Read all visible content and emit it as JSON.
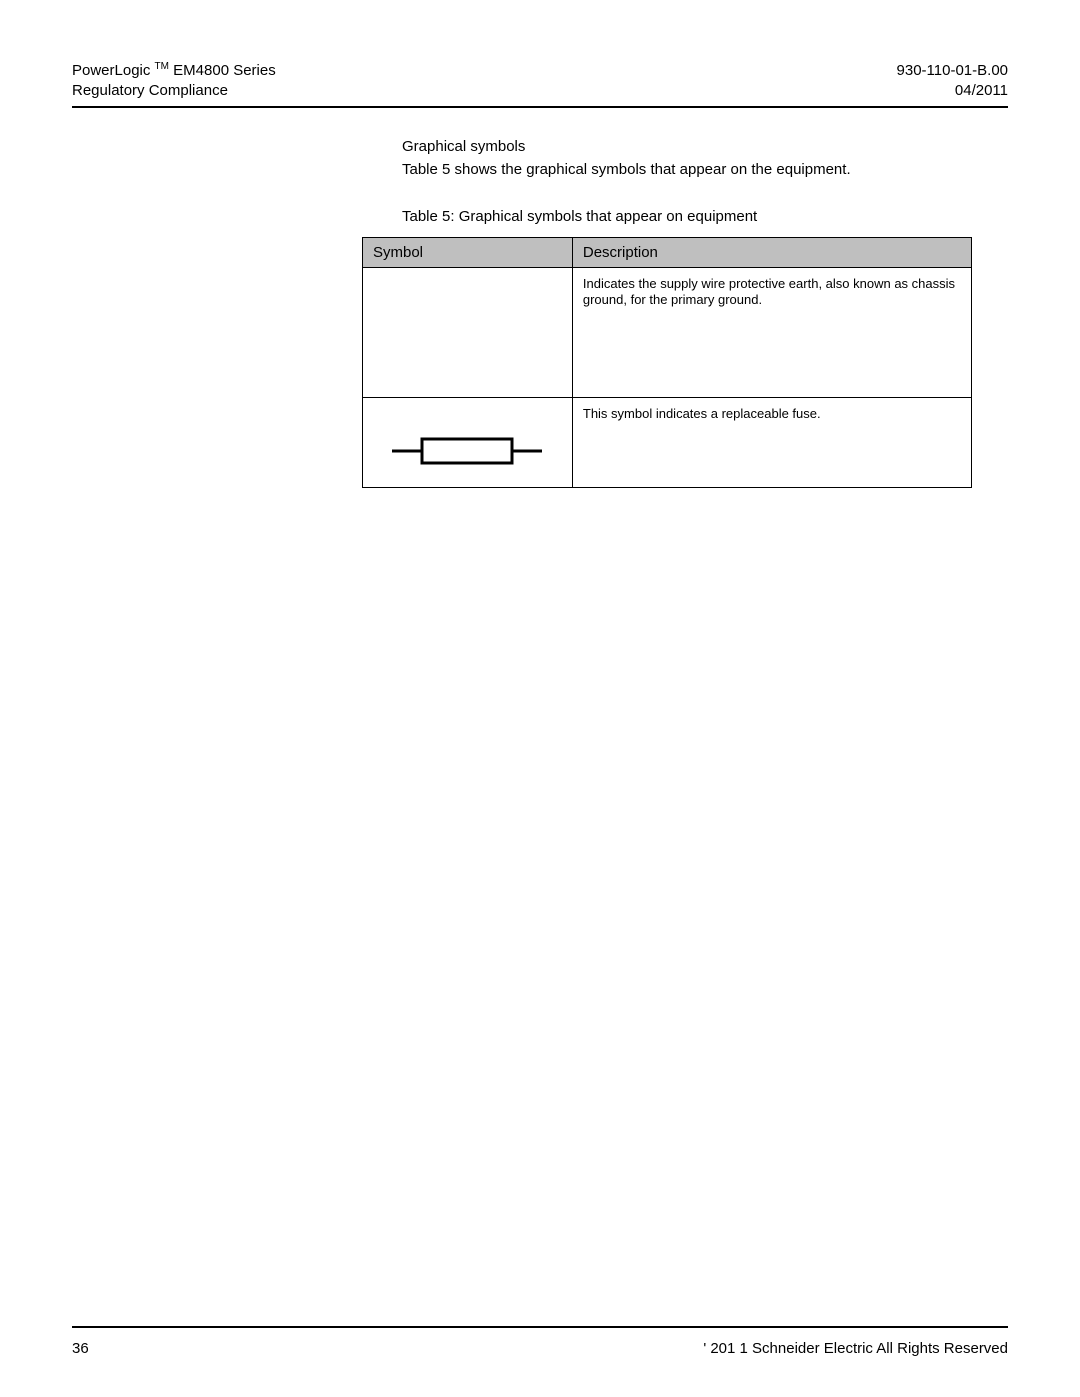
{
  "header": {
    "left_line1_pre": "PowerLogic ",
    "left_line1_tm": "TM",
    "left_line1_post": " EM4800 Series",
    "left_line2": "Regulatory Compliance",
    "right_line1": "930-110-01-B.00",
    "right_line2": "04/2011"
  },
  "content": {
    "section_title": "Graphical symbols",
    "intro": "Table 5 shows the graphical symbols that appear on the equipment.",
    "caption": "Table 5:  Graphical symbols that appear on equipment",
    "table": {
      "headers": {
        "symbol": "Symbol",
        "description": "Description"
      },
      "rows": [
        {
          "description": "Indicates the supply wire protective earth, also known as chassis ground, for the primary ground."
        },
        {
          "description": "This symbol indicates a replaceable fuse."
        }
      ]
    }
  },
  "footer": {
    "page_number": "36",
    "copyright": "' 201 1 Schneider Electric All Rights Reserved"
  }
}
